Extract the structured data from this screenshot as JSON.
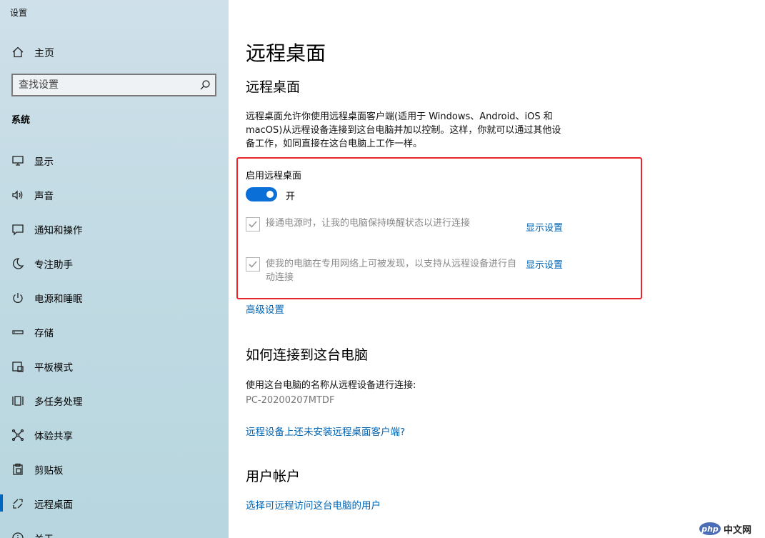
{
  "window": {
    "title": "设置"
  },
  "sidebar": {
    "home_label": "主页",
    "search_placeholder": "查找设置",
    "section_title": "系统",
    "items": [
      {
        "label": "显示",
        "icon": "monitor-icon"
      },
      {
        "label": "声音",
        "icon": "speaker-icon"
      },
      {
        "label": "通知和操作",
        "icon": "message-icon"
      },
      {
        "label": "专注助手",
        "icon": "moon-icon"
      },
      {
        "label": "电源和睡眠",
        "icon": "power-icon"
      },
      {
        "label": "存储",
        "icon": "storage-icon"
      },
      {
        "label": "平板模式",
        "icon": "tablet-icon"
      },
      {
        "label": "多任务处理",
        "icon": "multitask-icon"
      },
      {
        "label": "体验共享",
        "icon": "share-icon"
      },
      {
        "label": "剪贴板",
        "icon": "clipboard-icon"
      },
      {
        "label": "远程桌面",
        "icon": "remote-icon",
        "active": true
      },
      {
        "label": "关于",
        "icon": "info-icon"
      }
    ]
  },
  "main": {
    "page_title": "远程桌面",
    "section_title": "远程桌面",
    "description": "远程桌面允许你使用远程桌面客户端(适用于 Windows、Android、iOS 和 macOS)从远程设备连接到这台电脑并加以控制。这样，你就可以通过其他设备工作，如同直接在这台电脑上工作一样。",
    "enable_label": "启用远程桌面",
    "toggle_state": "开",
    "checkbox1_text": "接通电源时，让我的电脑保持唤醒状态以进行连接",
    "checkbox2_text": "使我的电脑在专用网络上可被发现，以支持从远程设备进行自动连接",
    "show_settings_1": "显示设置",
    "show_settings_2": "显示设置",
    "advanced_settings": "高级设置",
    "how_to_title": "如何连接到这台电脑",
    "how_to_desc": "使用这台电脑的名称从远程设备进行连接:",
    "pc_name": "PC-20200207MTDF",
    "no_client_link": "远程设备上还未安装远程桌面客户端?",
    "user_accounts_title": "用户帐户",
    "select_users_link": "选择可远程访问这台电脑的用户"
  },
  "watermark": {
    "logo": "php",
    "text": "中文网"
  },
  "colors": {
    "accent": "#0067c0",
    "link": "#0063b1",
    "highlight": "#e8262b"
  }
}
